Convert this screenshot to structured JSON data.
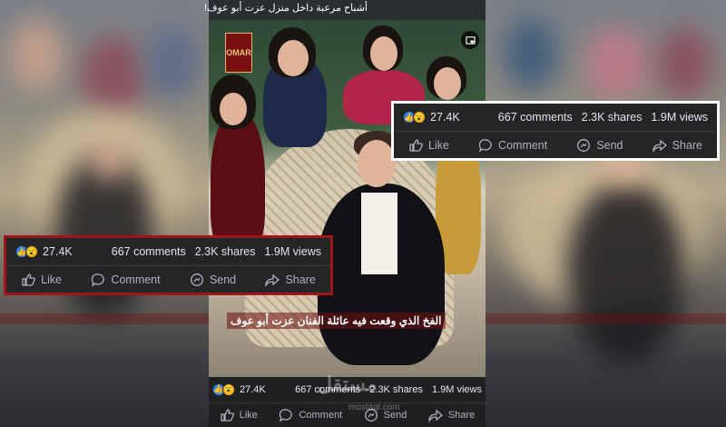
{
  "header": {
    "title": "أشباح مرعبة داخل منزل عزت أبو عوف!"
  },
  "video": {
    "logo_text": "OMAR",
    "subtitle": "الفخ الذي وقعت فيه عائلة الفنان عزت أبو عوف",
    "pip_icon": "picture-in-picture-icon"
  },
  "engagement": {
    "reaction_count": "27.4K",
    "comments": "667 comments",
    "shares": "2.3K shares",
    "views": "1.9M views",
    "actions": {
      "like": "Like",
      "comment": "Comment",
      "send": "Send",
      "share": "Share"
    }
  },
  "watermark": {
    "text": "مستقل",
    "sub": "mostaql.com"
  },
  "colors": {
    "highlight_red": "#a0141c",
    "highlight_white": "#ffffff",
    "fb_blue": "#2d88ff",
    "wow_yellow": "#f7b125",
    "bar_bg": "#242526"
  }
}
